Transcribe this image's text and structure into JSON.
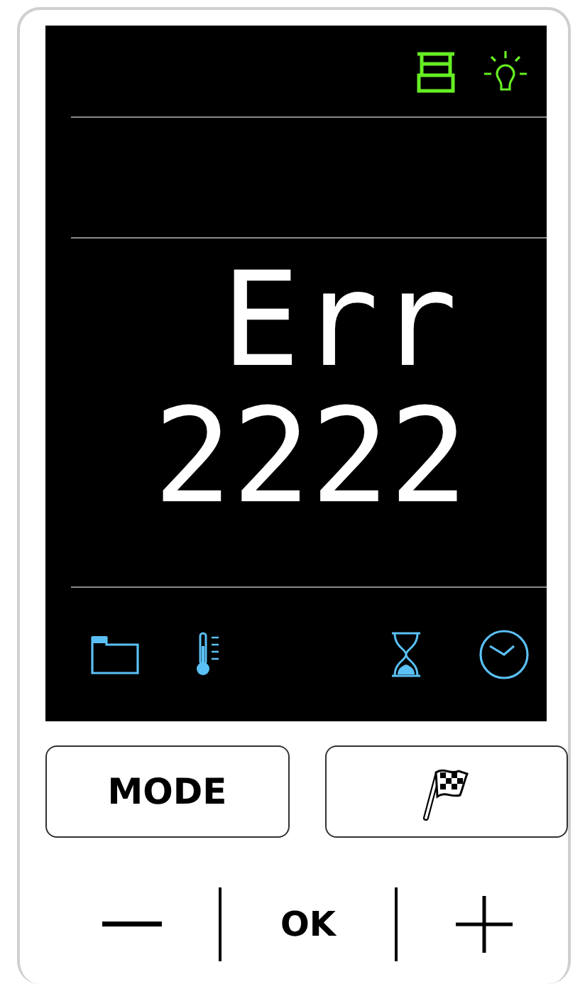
{
  "display": {
    "line_1": "Err",
    "line_2": "2222"
  },
  "buttons": [
    {
      "kind": "text",
      "label": "MODE"
    },
    {
      "kind": "flag"
    }
  ],
  "keys": [
    {
      "kind": "minus"
    },
    {
      "kind": "text",
      "label": "OK"
    },
    {
      "kind": "plus"
    }
  ]
}
